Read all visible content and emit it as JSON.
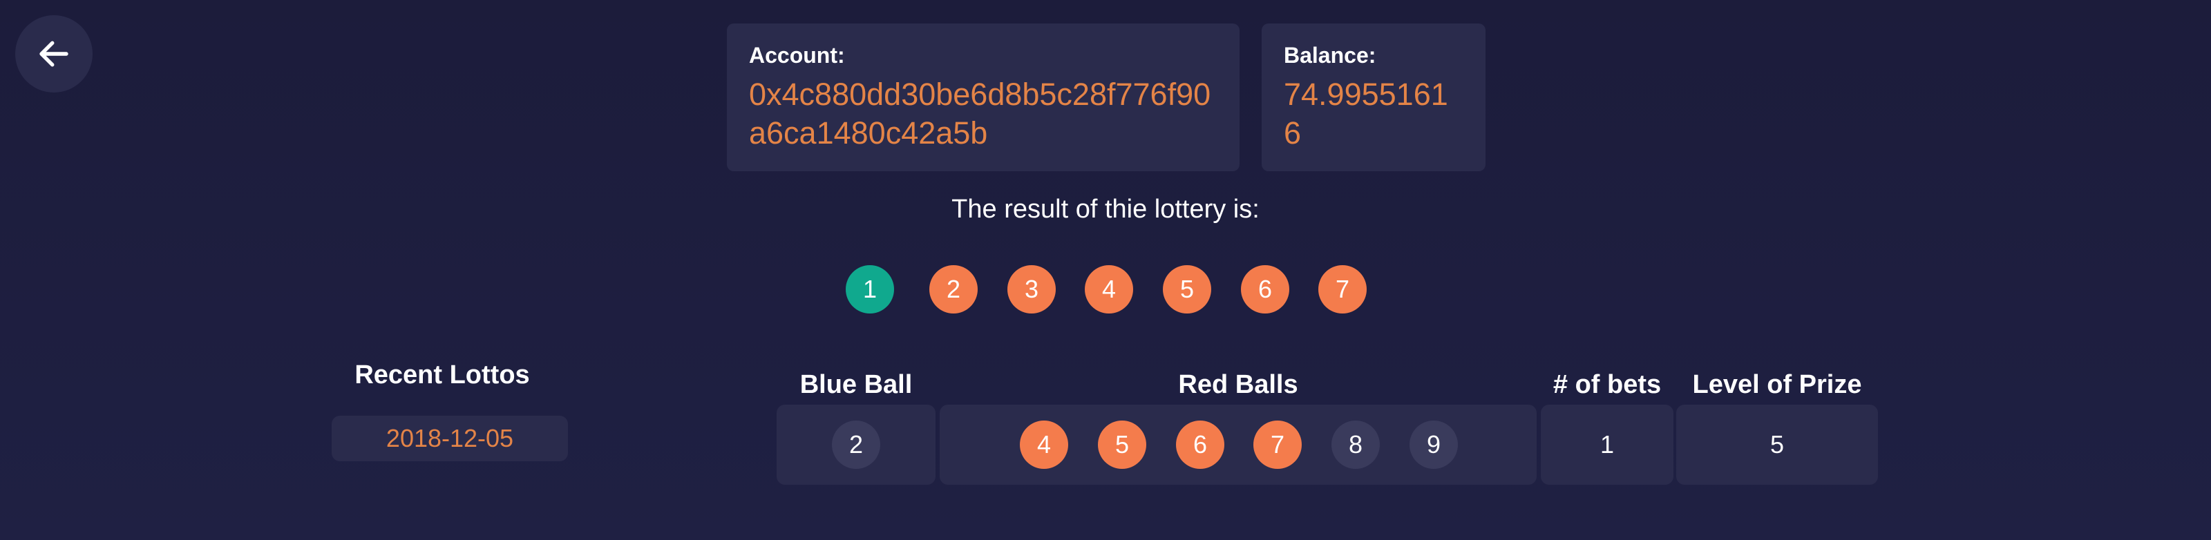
{
  "nav": {
    "back_icon": "arrow-left-icon"
  },
  "account": {
    "label": "Account:",
    "value": "0x4c880dd30be6d8b5c28f776f90a6ca1480c42a5b"
  },
  "balance": {
    "label": "Balance:",
    "value": "74.99551616"
  },
  "result": {
    "text": "The result of thie lottery is:",
    "blue_ball": "1",
    "red_balls": [
      "2",
      "3",
      "4",
      "5",
      "6",
      "7"
    ]
  },
  "recent": {
    "title": "Recent Lottos",
    "items": [
      "2018-12-05"
    ]
  },
  "bet_table": {
    "headers": {
      "blue": "Blue Ball",
      "red": "Red Balls",
      "bets": "# of bets",
      "prize": "Level of Prize"
    },
    "row": {
      "blue_ball": {
        "number": "2",
        "matched": false
      },
      "red_balls": [
        {
          "number": "4",
          "matched": true
        },
        {
          "number": "5",
          "matched": true
        },
        {
          "number": "6",
          "matched": true
        },
        {
          "number": "7",
          "matched": true
        },
        {
          "number": "8",
          "matched": false
        },
        {
          "number": "9",
          "matched": false
        }
      ],
      "bets": "1",
      "prize_level": "5"
    }
  },
  "colors": {
    "background": "#1d1e3d",
    "card": "#2a2b4c",
    "accent_orange": "#e48447",
    "red_ball": "#f47c4c",
    "blue_ball": "#10a98e",
    "unmatched_ball": "#3a3b5c"
  }
}
